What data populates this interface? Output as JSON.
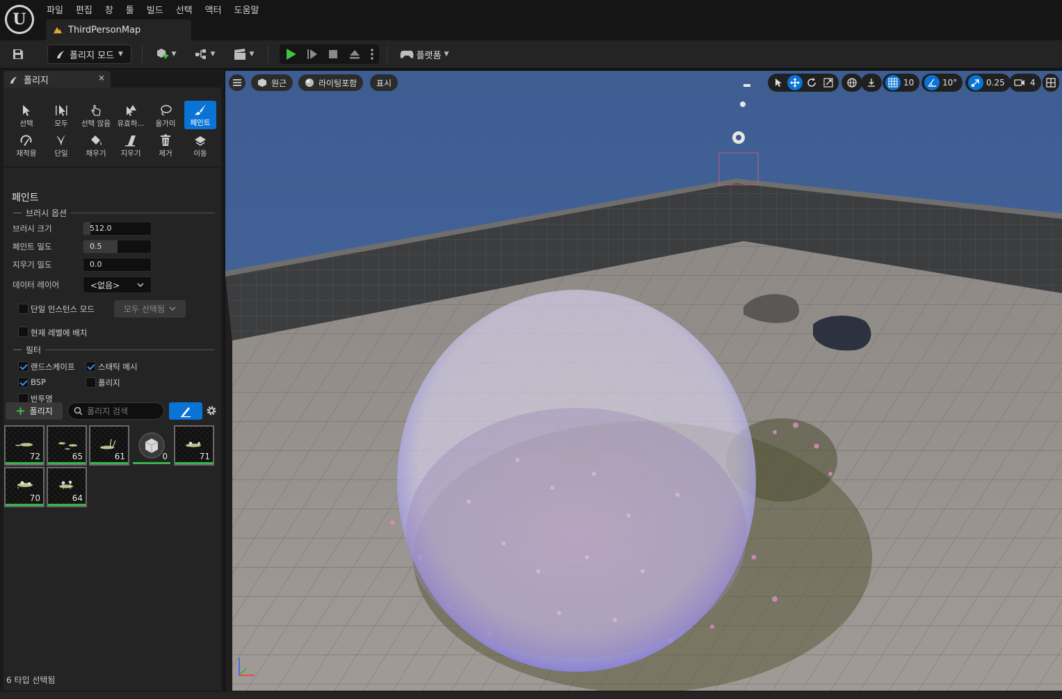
{
  "menu": [
    "파일",
    "편집",
    "창",
    "툴",
    "빌드",
    "선택",
    "액터",
    "도움말"
  ],
  "map_tab": "ThirdPersonMap",
  "toolbar": {
    "mode_label": "폴리지 모드",
    "platform_label": "플랫폼"
  },
  "panel": {
    "title": "폴리지",
    "close": "×",
    "tools_row1": [
      "선택",
      "모두",
      "선택 않음",
      "유효하...",
      "올가미",
      "페인트"
    ],
    "tools_row2": [
      "재적용",
      "단일",
      "채우기",
      "지우기",
      "제거",
      "이동"
    ],
    "section_title": "페인트",
    "brush_group": "브러시 옵션",
    "brush_size_label": "브러시 크기",
    "brush_size_value": "512.0",
    "brush_size_fraction": 0.1,
    "paint_density_label": "페인트 밀도",
    "paint_density_value": "0.5",
    "paint_density_fraction": 0.5,
    "erase_density_label": "지우기 밀도",
    "erase_density_value": "0.0",
    "data_layer_label": "데이터 레이어",
    "data_layer_value": "<없음>",
    "single_instance_label": "단일 인스턴스 모드",
    "select_all_label": "모두 선택됨",
    "current_level_label": "현재 레벨에 배치",
    "filter_group": "필터",
    "filters": {
      "landscape": "랜드스케이프",
      "static_mesh": "스태틱 메시",
      "bsp": "BSP",
      "foliage": "폴리지",
      "translucent": "반투명"
    },
    "add_foliage_label": "폴리지",
    "search_placeholder": "폴리지 검색",
    "thumbnails": [
      "72",
      "65",
      "61",
      "0",
      "71",
      "70",
      "64"
    ],
    "status": "6 타입 선택됨"
  },
  "viewport": {
    "perspective": "원근",
    "lighting": "라이팅포함",
    "show": "표시",
    "grid_snap": "10",
    "rotation_snap": "10°",
    "scale_snap": "0.25",
    "camera_speed": "4"
  }
}
